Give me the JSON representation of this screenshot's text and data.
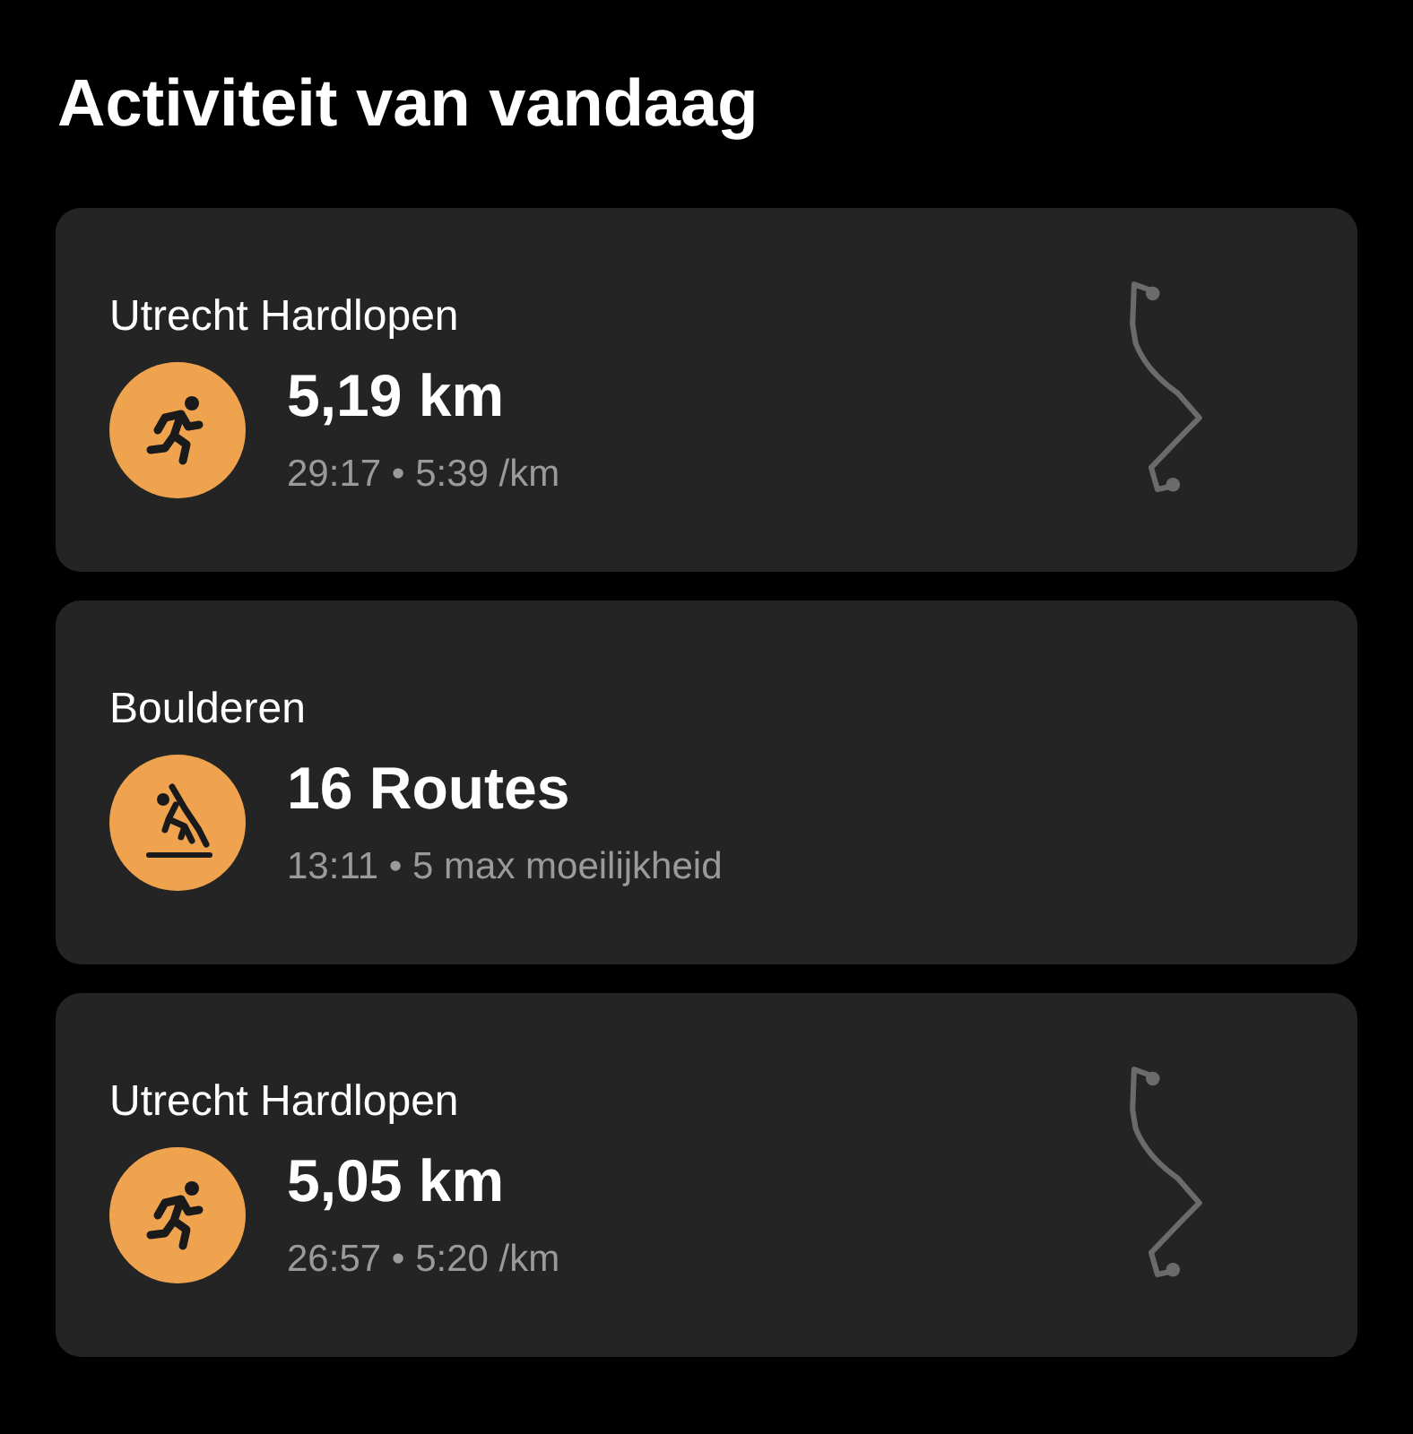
{
  "title": "Activiteit van vandaag",
  "activities": [
    {
      "kind": "run",
      "name": "Utrecht Hardlopen",
      "value": "5,19 km",
      "details": "29:17 • 5:39 /km"
    },
    {
      "kind": "climb",
      "name": "Boulderen",
      "value": "16 Routes",
      "details": "13:11 • 5 max moeilijkheid"
    },
    {
      "kind": "run",
      "name": "Utrecht Hardlopen",
      "value": "5,05 km",
      "details": "26:57 • 5:20 /km"
    }
  ]
}
